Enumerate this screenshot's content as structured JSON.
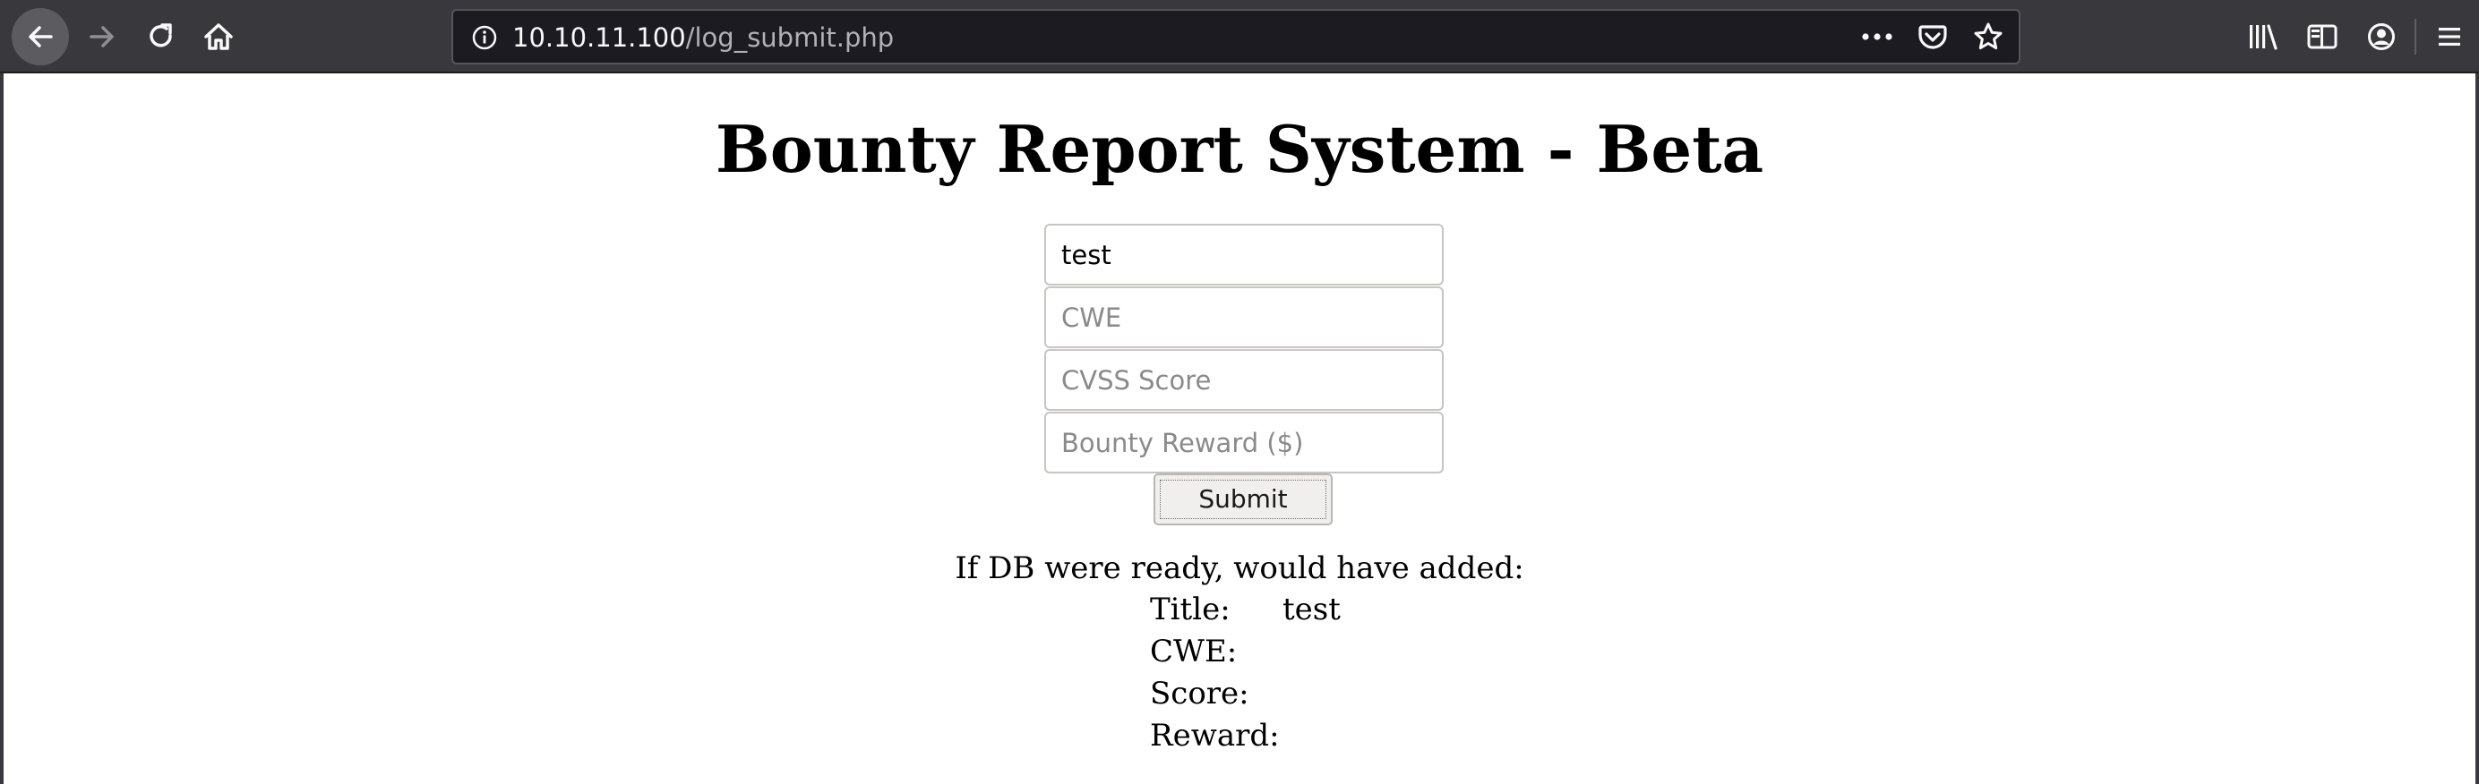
{
  "browser": {
    "url_host": "10.10.11.100",
    "url_path": "/log_submit.php",
    "icons": {
      "back": "back-arrow-icon",
      "forward": "forward-arrow-icon",
      "reload": "reload-icon",
      "home": "home-icon",
      "info": "info-icon",
      "more": "more-actions-icon",
      "pocket": "pocket-icon",
      "bookmark": "bookmark-star-icon",
      "library": "library-icon",
      "sidebar": "sidebar-icon",
      "account": "account-icon",
      "menu": "hamburger-menu-icon"
    },
    "colors": {
      "chrome": "#38383d",
      "urlbar": "#1c1b22",
      "url_host": "#f9f9fa",
      "url_path": "#b1b1b3"
    }
  },
  "page": {
    "title": "Bounty Report System - Beta",
    "form": {
      "title_field": {
        "value": "test",
        "placeholder": ""
      },
      "cwe_field": {
        "value": "",
        "placeholder": "CWE"
      },
      "cvss_field": {
        "value": "",
        "placeholder": "CVSS Score"
      },
      "reward_field": {
        "value": "",
        "placeholder": "Bounty Reward ($)"
      },
      "submit_label": "Submit"
    },
    "result": {
      "heading": "If DB were ready, would have added:",
      "rows": [
        {
          "label": "Title:",
          "value": "test"
        },
        {
          "label": "CWE:",
          "value": ""
        },
        {
          "label": "Score:",
          "value": ""
        },
        {
          "label": "Reward:",
          "value": ""
        }
      ]
    }
  }
}
